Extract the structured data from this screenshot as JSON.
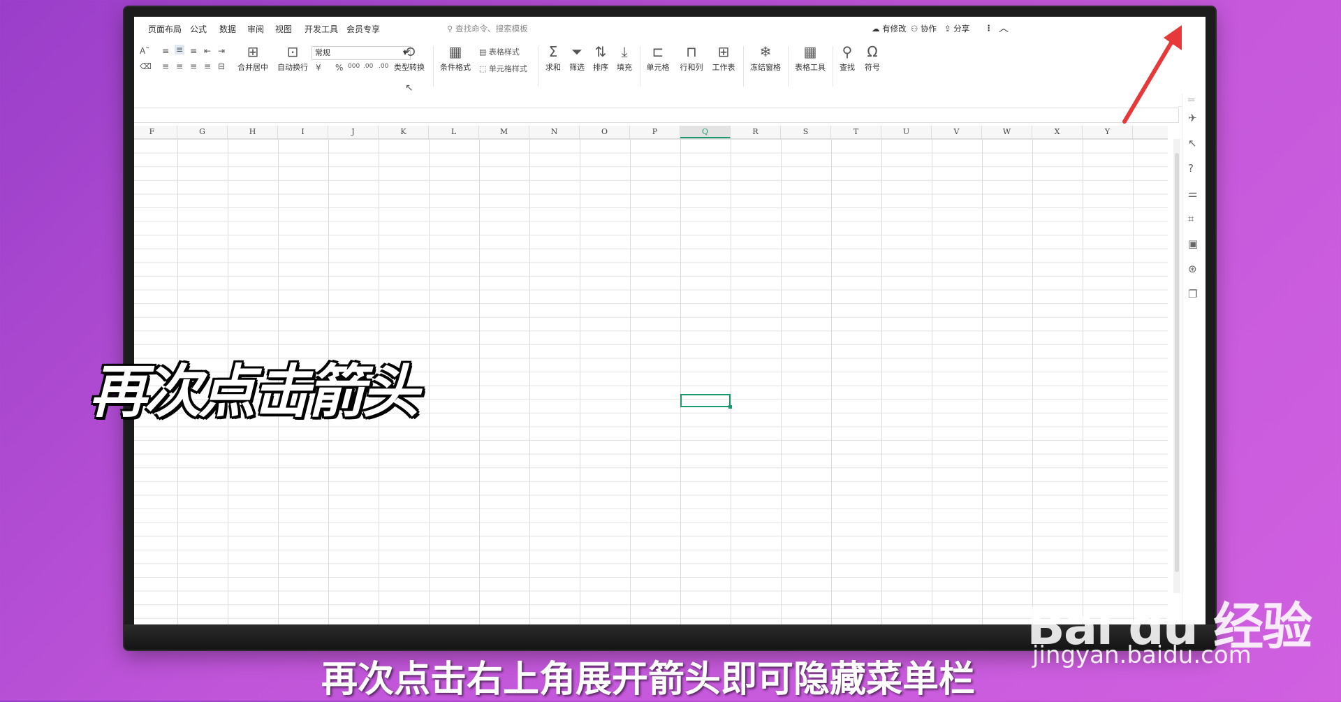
{
  "tabs": [
    "页面布局",
    "公式",
    "数据",
    "审阅",
    "视图",
    "开发工具",
    "会员专享"
  ],
  "search_text": "查找命令、搜索模板",
  "right_actions": [
    "有修改",
    "协作",
    "分享"
  ],
  "ribbon": {
    "merge": "合并居中",
    "wrap": "自动换行",
    "number_format": "常规",
    "currency": "¥",
    "percent": "%",
    "thousands": "000",
    "inc_decimal": ".00",
    "dec_decimal": ".00",
    "type_convert": "类型转换",
    "cond_format": "条件格式",
    "table_style": "表格样式",
    "cell_style": "单元格样式",
    "sum": "求和",
    "filter": "筛选",
    "sort": "排序",
    "fill": "填充",
    "cell": "单元格",
    "rowcol": "行和列",
    "sheet": "工作表",
    "freeze": "冻结窗格",
    "table_tools": "表格工具",
    "find": "查找",
    "symbol": "符号"
  },
  "columns": [
    "F",
    "G",
    "H",
    "I",
    "J",
    "K",
    "L",
    "M",
    "N",
    "O",
    "P",
    "Q",
    "R",
    "S",
    "T",
    "U",
    "V",
    "W",
    "X",
    "Y"
  ],
  "selected_column": "Q",
  "overlay_text": "再次点击箭头",
  "caption": "再次点击右上角展开箭头即可隐藏菜单栏",
  "watermark": "Bai du 经验",
  "watermark_url": "jingyan.baidu.com",
  "accent_color": "#1a9a6a",
  "arrow_color": "#e8393a"
}
